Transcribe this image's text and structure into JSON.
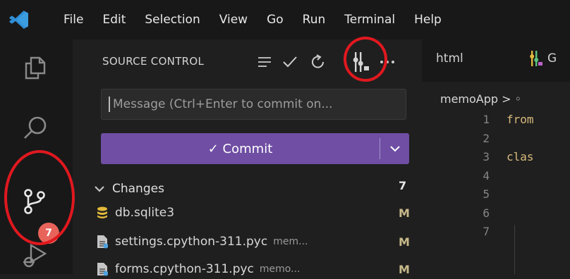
{
  "menu": {
    "items": [
      "File",
      "Edit",
      "Selection",
      "View",
      "Go",
      "Run",
      "Terminal",
      "Help"
    ]
  },
  "activity_bar": {
    "source_control_badge": "7"
  },
  "source_control": {
    "title": "SOURCE CONTROL",
    "message_placeholder": "Message (Ctrl+Enter to commit on...",
    "commit_label": "✓ Commit",
    "changes_label": "Changes",
    "changes_count": "7",
    "files": [
      {
        "name": "db.sqlite3",
        "dir": "",
        "status": "M",
        "icon": "database-icon"
      },
      {
        "name": "settings.cpython-311.pyc",
        "dir": "mem...",
        "status": "M",
        "icon": "file-icon"
      },
      {
        "name": "forms.cpython-311.pyc",
        "dir": "memo...",
        "status": "M",
        "icon": "file-icon"
      }
    ]
  },
  "editor": {
    "tabs": [
      {
        "label": "html"
      },
      {
        "label": "G"
      }
    ],
    "breadcrumb": "memoApp > ◦",
    "line_numbers": [
      "1",
      "2",
      "3",
      "4",
      "5",
      "6",
      "7"
    ],
    "code_lines": [
      "from",
      "",
      "clas",
      "",
      "",
      "",
      ""
    ]
  },
  "colors": {
    "accent_button": "#6f4ea3",
    "badge": "#e8645b",
    "annotation": "#e0181f",
    "keyword": "#d7ba7d"
  }
}
